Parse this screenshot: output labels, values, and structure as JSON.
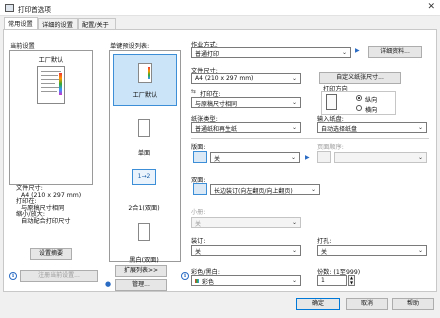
{
  "window": {
    "title": "打印首选项",
    "close": "✕"
  },
  "tabs": [
    {
      "label": "常用设置",
      "active": true
    },
    {
      "label": "详细的设置",
      "active": false
    },
    {
      "label": "配置/关于",
      "active": false
    }
  ],
  "current_settings": {
    "label": "当前设置",
    "preview_caption": "工厂默认",
    "summary_lines": [
      "文件尺寸:",
      "A4 (210 x 297 mm)",
      "打印在:",
      "与原稿尺寸相同",
      "缩小/放大:",
      "自动配合打印尺寸"
    ],
    "summary_button": "设置摘要",
    "register_button": "注册当前设置..."
  },
  "favorites": {
    "label": "单键预设列表:",
    "items": [
      {
        "label": "工厂默认",
        "selected": true
      },
      {
        "label": "单面",
        "selected": false
      },
      {
        "label": "2合1(双面)",
        "selected": false,
        "icon_text": "1→2"
      },
      {
        "label": "黑白(双面)",
        "selected": false
      }
    ],
    "expand_button": "扩展列表>>",
    "manage_button": "管理..."
  },
  "job_type": {
    "label": "作业方式:",
    "value": "普通打印",
    "details_button": "详细资料..."
  },
  "document_size": {
    "label": "文件尺寸:",
    "value": "A4 (210 x 297 mm)",
    "custom_button": "自定义纸张尺寸..."
  },
  "print_on": {
    "label": "打印在:",
    "value": "与原稿尺寸相同"
  },
  "orientation": {
    "label": "打印方向",
    "options": [
      {
        "label": "纵向",
        "checked": true
      },
      {
        "label": "横向",
        "checked": false
      }
    ]
  },
  "paper_type": {
    "label": "纸张类型:",
    "value": "普通纸和再生纸"
  },
  "input_tray": {
    "label": "输入纸盘:",
    "value": "自动选择纸盘"
  },
  "duplex_sides": {
    "label": "版面:",
    "value": "关"
  },
  "page_order": {
    "label": "页面顺序:",
    "value": ""
  },
  "duplex": {
    "label": "双面:",
    "value": "长边装订(向左翻页/向上翻页)"
  },
  "staple_hidden": {
    "label": "小册:",
    "value": "关"
  },
  "staple": {
    "label": "装订:",
    "value": "关"
  },
  "punch": {
    "label": "打孔:",
    "value": "关"
  },
  "color": {
    "label": "彩色/黑白:",
    "value": "彩色"
  },
  "copies": {
    "label": "份数: (1至999)",
    "value": "1"
  },
  "footer": {
    "ok": "确定",
    "cancel": "取消",
    "help": "帮助"
  },
  "colors": {
    "accent": "#0078d7",
    "selected_bg": "#cce4f7"
  }
}
